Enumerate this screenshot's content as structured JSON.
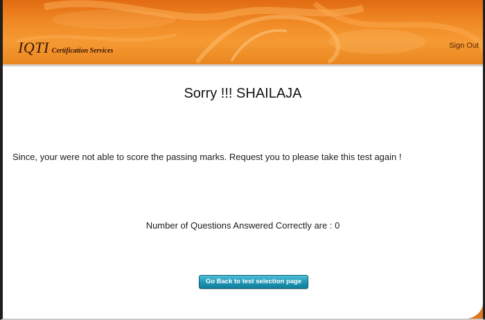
{
  "header": {
    "logo_main": "IQTI",
    "logo_sub": "Certification Services",
    "signout_label": "Sign Out"
  },
  "result": {
    "title": "Sorry !!! SHAILAJA",
    "message": "Since, your were not able to score the passing marks. Request you to please take this test again !",
    "score_text": "Number of Questions Answered Correctly are : 0"
  },
  "actions": {
    "back_label": "Go Back to test selection page"
  },
  "colors": {
    "header_orange": "#f08a25",
    "button_teal": "#1e97b6"
  }
}
